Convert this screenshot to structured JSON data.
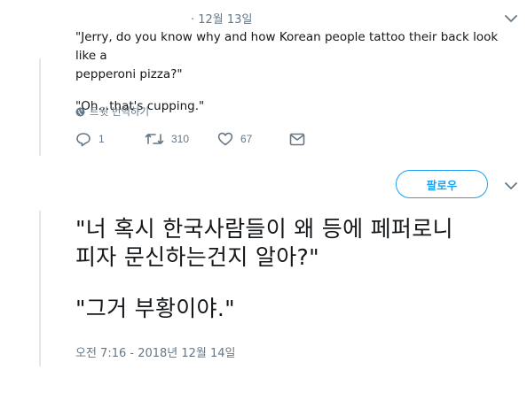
{
  "tweet1": {
    "date": "· 12월 13일",
    "text_line1": "\"Jerry, do you know why and how Korean people tattoo their back look like a",
    "text_line2": "pepperoni pizza?\"",
    "text_line3": "\"Oh...that's cupping.\"",
    "translate_label": "트윗 번역하기",
    "actions": {
      "reply_count": "1",
      "retweet_count": "310",
      "like_count": "67"
    }
  },
  "tweet2": {
    "follow_label": "팔로우",
    "text_line1": "\"너 혹시 한국사람들이 왜 등에 페퍼로니",
    "text_line2": "피자 문신하는건지 알아?\"",
    "text_line3": "\"그거 부황이야.\"",
    "timestamp": "오전 7:16 - 2018년 12월 14일"
  },
  "colors": {
    "accent": "#1da1f2",
    "muted": "#657786",
    "text": "#14171a",
    "thread_line": "#e1e8ed"
  }
}
